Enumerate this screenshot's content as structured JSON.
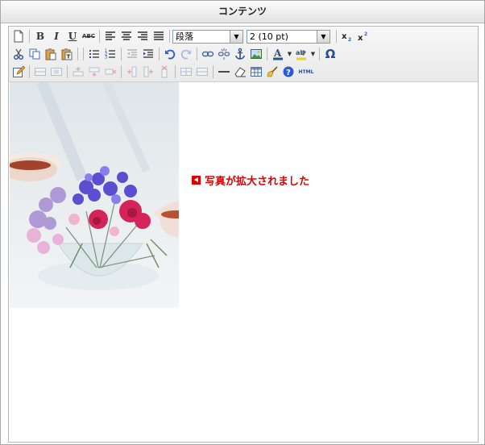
{
  "window": {
    "title": "コンテンツ"
  },
  "toolbar": {
    "format_select": {
      "value": "段落"
    },
    "size_select": {
      "value": "2 (10 pt)"
    },
    "row1": [
      "new-document",
      "bold",
      "italic",
      "underline",
      "strikethrough",
      "align-left",
      "align-center",
      "align-right",
      "align-justify",
      "subscript",
      "superscript"
    ],
    "row2": [
      "cut",
      "copy",
      "paste",
      "paste-text",
      "unordered-list",
      "ordered-list",
      "outdent",
      "indent",
      "undo",
      "redo",
      "link",
      "unlink",
      "anchor",
      "image",
      "text-color",
      "highlight-color",
      "special-char"
    ],
    "row3": [
      "edit-source",
      "table-row-props",
      "table-cell-props",
      "insert-row",
      "delete-row",
      "insert-column",
      "delete-column",
      "merge",
      "split",
      "horizontal-rule",
      "eraser",
      "insert-table",
      "cleanup",
      "help",
      "html"
    ]
  },
  "labels": {
    "bold": "B",
    "italic": "I",
    "underline": "U",
    "strike": "ABC",
    "omega": "Ω",
    "html": "HTML"
  },
  "colors": {
    "accent_red": "#e00000",
    "border": "#b7b7b7",
    "toolbar_bg": "#eeeeee"
  },
  "content": {
    "image_alt": "flower arrangement photo",
    "note": "写真が拡大されました"
  }
}
